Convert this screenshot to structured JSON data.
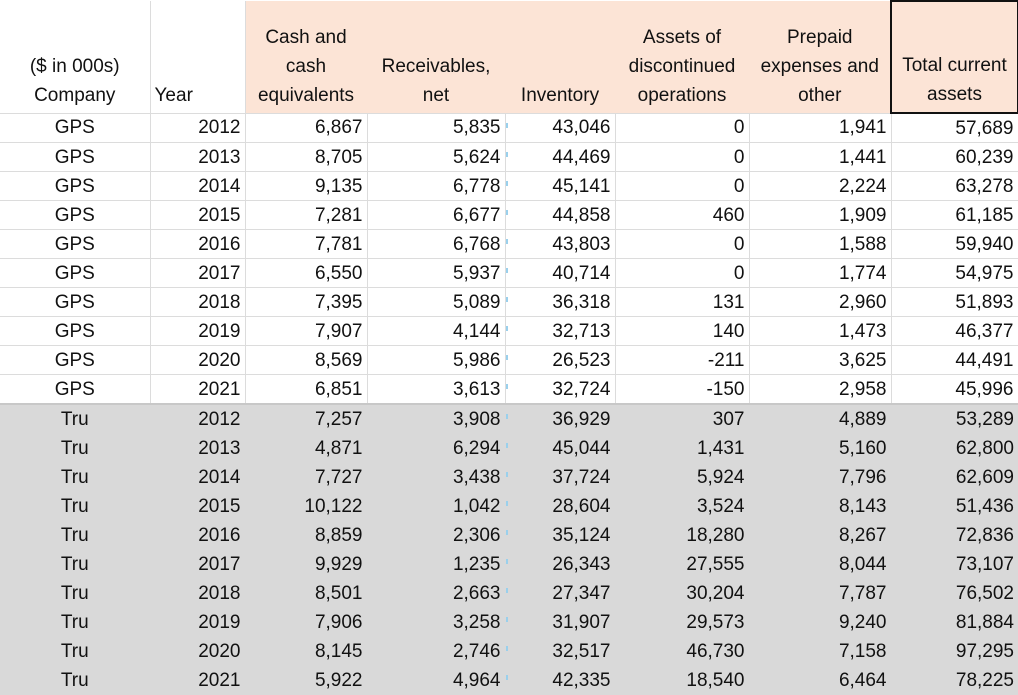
{
  "sheet": {
    "units_note": "($ in 000s)",
    "columns": [
      {
        "key": "company",
        "label_lines": [
          "($ in 000s)",
          "Company"
        ]
      },
      {
        "key": "year",
        "label_lines": [
          "Year"
        ]
      },
      {
        "key": "cash",
        "label_lines": [
          "Cash and",
          "cash",
          "equivalents"
        ]
      },
      {
        "key": "receivables",
        "label_lines": [
          "Receivables,",
          "net"
        ]
      },
      {
        "key": "inventory",
        "label_lines": [
          "Inventory"
        ]
      },
      {
        "key": "discontinued",
        "label_lines": [
          "Assets of",
          "discontinued",
          "operations"
        ]
      },
      {
        "key": "prepaid",
        "label_lines": [
          "Prepaid",
          "expenses and",
          "other"
        ]
      },
      {
        "key": "total",
        "label_lines": [
          "Total current",
          "assets"
        ]
      }
    ],
    "colors": {
      "header_highlight": "#fce4d6",
      "group_shade": "#d9d9d9",
      "gridline": "#dcdcdc"
    },
    "rows": [
      {
        "company": "GPS",
        "year": "2012",
        "cash": "6,867",
        "receivables": "5,835",
        "inventory": "43,046",
        "discontinued": "0",
        "prepaid": "1,941",
        "total": "57,689"
      },
      {
        "company": "GPS",
        "year": "2013",
        "cash": "8,705",
        "receivables": "5,624",
        "inventory": "44,469",
        "discontinued": "0",
        "prepaid": "1,441",
        "total": "60,239"
      },
      {
        "company": "GPS",
        "year": "2014",
        "cash": "9,135",
        "receivables": "6,778",
        "inventory": "45,141",
        "discontinued": "0",
        "prepaid": "2,224",
        "total": "63,278"
      },
      {
        "company": "GPS",
        "year": "2015",
        "cash": "7,281",
        "receivables": "6,677",
        "inventory": "44,858",
        "discontinued": "460",
        "prepaid": "1,909",
        "total": "61,185"
      },
      {
        "company": "GPS",
        "year": "2016",
        "cash": "7,781",
        "receivables": "6,768",
        "inventory": "43,803",
        "discontinued": "0",
        "prepaid": "1,588",
        "total": "59,940"
      },
      {
        "company": "GPS",
        "year": "2017",
        "cash": "6,550",
        "receivables": "5,937",
        "inventory": "40,714",
        "discontinued": "0",
        "prepaid": "1,774",
        "total": "54,975"
      },
      {
        "company": "GPS",
        "year": "2018",
        "cash": "7,395",
        "receivables": "5,089",
        "inventory": "36,318",
        "discontinued": "131",
        "prepaid": "2,960",
        "total": "51,893"
      },
      {
        "company": "GPS",
        "year": "2019",
        "cash": "7,907",
        "receivables": "4,144",
        "inventory": "32,713",
        "discontinued": "140",
        "prepaid": "1,473",
        "total": "46,377"
      },
      {
        "company": "GPS",
        "year": "2020",
        "cash": "8,569",
        "receivables": "5,986",
        "inventory": "26,523",
        "discontinued": "-211",
        "prepaid": "3,625",
        "total": "44,491"
      },
      {
        "company": "GPS",
        "year": "2021",
        "cash": "6,851",
        "receivables": "3,613",
        "inventory": "32,724",
        "discontinued": "-150",
        "prepaid": "2,958",
        "total": "45,996"
      },
      {
        "company": "Tru",
        "year": "2012",
        "cash": "7,257",
        "receivables": "3,908",
        "inventory": "36,929",
        "discontinued": "307",
        "prepaid": "4,889",
        "total": "53,289"
      },
      {
        "company": "Tru",
        "year": "2013",
        "cash": "4,871",
        "receivables": "6,294",
        "inventory": "45,044",
        "discontinued": "1,431",
        "prepaid": "5,160",
        "total": "62,800"
      },
      {
        "company": "Tru",
        "year": "2014",
        "cash": "7,727",
        "receivables": "3,438",
        "inventory": "37,724",
        "discontinued": "5,924",
        "prepaid": "7,796",
        "total": "62,609"
      },
      {
        "company": "Tru",
        "year": "2015",
        "cash": "10,122",
        "receivables": "1,042",
        "inventory": "28,604",
        "discontinued": "3,524",
        "prepaid": "8,143",
        "total": "51,436"
      },
      {
        "company": "Tru",
        "year": "2016",
        "cash": "8,859",
        "receivables": "2,306",
        "inventory": "35,124",
        "discontinued": "18,280",
        "prepaid": "8,267",
        "total": "72,836"
      },
      {
        "company": "Tru",
        "year": "2017",
        "cash": "9,929",
        "receivables": "1,235",
        "inventory": "26,343",
        "discontinued": "27,555",
        "prepaid": "8,044",
        "total": "73,107"
      },
      {
        "company": "Tru",
        "year": "2018",
        "cash": "8,501",
        "receivables": "2,663",
        "inventory": "27,347",
        "discontinued": "30,204",
        "prepaid": "7,787",
        "total": "76,502"
      },
      {
        "company": "Tru",
        "year": "2019",
        "cash": "7,906",
        "receivables": "3,258",
        "inventory": "31,907",
        "discontinued": "29,573",
        "prepaid": "9,240",
        "total": "81,884"
      },
      {
        "company": "Tru",
        "year": "2020",
        "cash": "8,145",
        "receivables": "2,746",
        "inventory": "32,517",
        "discontinued": "46,730",
        "prepaid": "7,158",
        "total": "97,295"
      },
      {
        "company": "Tru",
        "year": "2021",
        "cash": "5,922",
        "receivables": "4,964",
        "inventory": "42,335",
        "discontinued": "18,540",
        "prepaid": "6,464",
        "total": "78,225"
      }
    ]
  }
}
